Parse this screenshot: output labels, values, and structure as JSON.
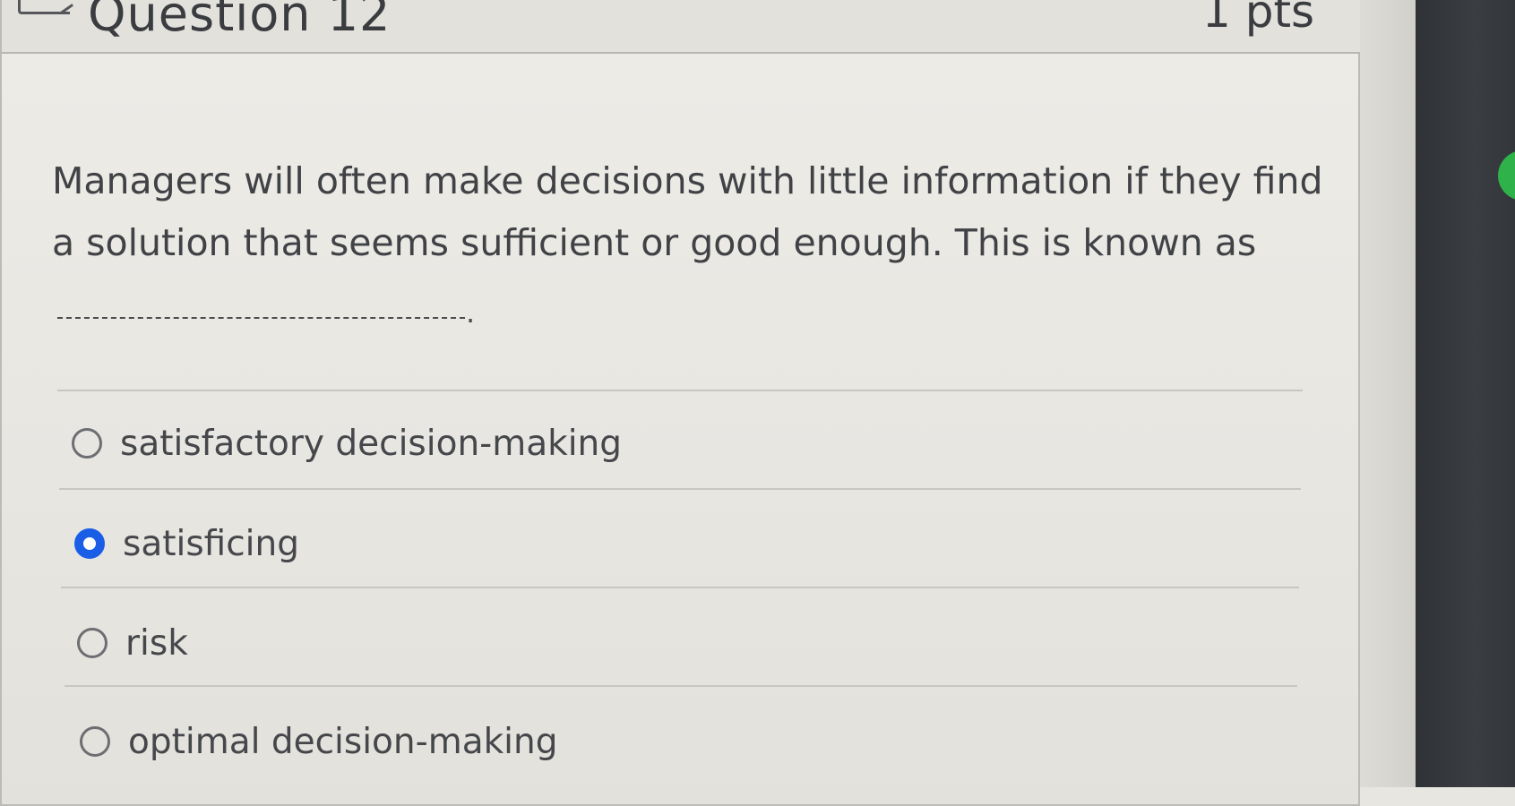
{
  "question": {
    "title": "Question 12",
    "points": "1 pts",
    "text": "Managers will often make decisions with little information if they find a solution that seems sufficient or good enough. This is known as",
    "blank_period": "."
  },
  "options": [
    {
      "label": "satisfactory decision-making",
      "selected": false
    },
    {
      "label": "satisficing",
      "selected": true
    },
    {
      "label": "risk",
      "selected": false
    },
    {
      "label": "optimal decision-making",
      "selected": false
    }
  ],
  "colors": {
    "selected_radio": "#1a5ee8",
    "side_indicator": "#2fb24a"
  }
}
